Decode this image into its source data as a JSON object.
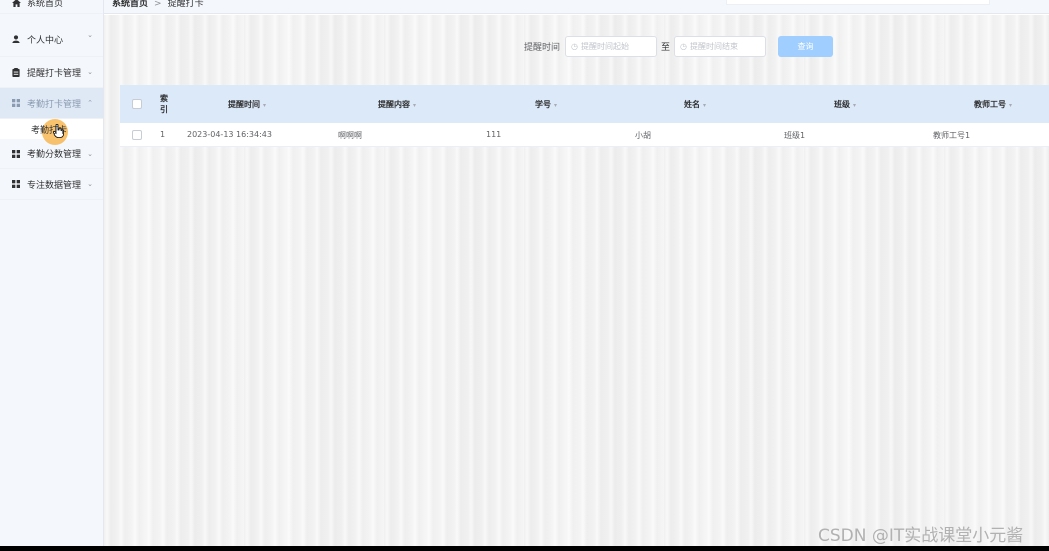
{
  "sidebar": {
    "items": [
      {
        "label": "系统首页",
        "icon": "home-icon"
      },
      {
        "label": "个人中心",
        "icon": "user-icon"
      },
      {
        "label": "提醒打卡管理",
        "icon": "clipboard-icon"
      },
      {
        "label": "考勤打卡管理",
        "icon": "grid-icon"
      },
      {
        "label": "考勤分数管理",
        "icon": "grid-icon"
      },
      {
        "label": "专注数据管理",
        "icon": "grid-icon"
      }
    ],
    "subitem": {
      "label": "考勤打卡"
    }
  },
  "breadcrumb": {
    "home": "系统首页",
    "separator": ">",
    "current": "提醒打卡"
  },
  "search": {
    "label": "提醒时间",
    "start_placeholder": "提醒时间起始",
    "to": "至",
    "end_placeholder": "提醒时间结束",
    "button": "查询"
  },
  "table": {
    "columns": [
      "索引",
      "提醒时间",
      "提醒内容",
      "学号",
      "姓名",
      "班级",
      "教师工号"
    ],
    "rows": [
      {
        "index": "1",
        "time": "2023-04-13 16:34:43",
        "content": "啊啊啊",
        "student_id": "111",
        "name": "小胡",
        "class": "班级1",
        "teacher_id": "教师工号1"
      }
    ]
  },
  "watermark": "CSDN @IT实战课堂小元酱",
  "colors": {
    "accent": "#409eff",
    "header_bg": "#dce9f8",
    "button_bg": "#a0cfff",
    "cursor": "#f7ae3c"
  }
}
